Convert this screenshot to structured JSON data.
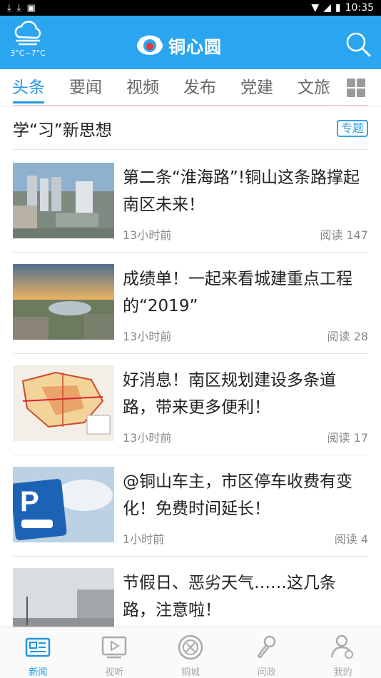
{
  "status_bar": {
    "time": "10:35",
    "icons": [
      "download-icon",
      "download-icon",
      "notification-icon",
      "wifi-icon",
      "signal-icon",
      "battery-icon"
    ]
  },
  "header": {
    "weather_temp": "3°C~7°C",
    "app_name": "铜心圆",
    "icons": [
      "cloud-icon",
      "logo-eye-icon",
      "search-icon"
    ],
    "bg_color": "#2aa6f0"
  },
  "tabs": {
    "items": [
      "头条",
      "要闻",
      "视频",
      "发布",
      "党建",
      "文旅"
    ],
    "active_index": 0,
    "accent_color": "#2196e3"
  },
  "section": {
    "title": "学“习”新思想",
    "badge": "专题"
  },
  "news": [
    {
      "title": "第二条“淮海路”!铜山这条路撑起南区未来！",
      "time": "13小时前",
      "reads": "阅读 147"
    },
    {
      "title": "成绩单！一起来看城建重点工程的“2019”",
      "time": "13小时前",
      "reads": "阅读 28"
    },
    {
      "title": "好消息！南区规划建设多条道路，带来更多便利！",
      "time": "13小时前",
      "reads": "阅读 17"
    },
    {
      "title": " @铜山车主，市区停车收费有变化！免费时间延长！",
      "time": "1小时前",
      "reads": "阅读 4"
    },
    {
      "title": "节假日、恶劣天气……这几条路，注意啦！",
      "time": "",
      "reads": ""
    }
  ],
  "bottom_nav": {
    "items": [
      "新闻",
      "视听",
      "铜城",
      "问政",
      "我的"
    ],
    "active_index": 0
  }
}
